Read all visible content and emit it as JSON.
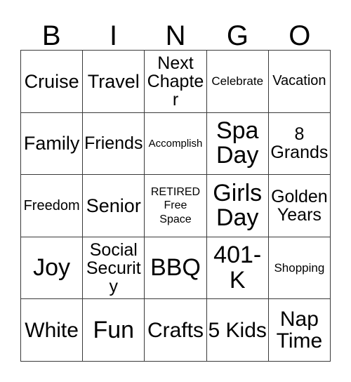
{
  "card": {
    "type": "bingo-card",
    "theme": "Retirement",
    "columns": 5,
    "rows": 5,
    "border_color": "#3a3a3a",
    "background_color": "#ffffff",
    "text_color": "#000000"
  },
  "header": {
    "letters": [
      "B",
      "I",
      "N",
      "G",
      "O"
    ]
  },
  "grid": {
    "rows": [
      [
        {
          "text": "Cruise",
          "size": "lg"
        },
        {
          "text": "Travel",
          "size": "lg"
        },
        {
          "text": "Next Chapter",
          "size": "md"
        },
        {
          "text": "Celebrate",
          "size": "xs"
        },
        {
          "text": "Vacation",
          "size": "sm"
        }
      ],
      [
        {
          "text": "Family",
          "size": "lg"
        },
        {
          "text": "Friends",
          "size": "md"
        },
        {
          "text": "Accomplish",
          "size": "xxs"
        },
        {
          "text": "Spa Day",
          "size": "xxl"
        },
        {
          "text": "8 Grands",
          "size": "md"
        }
      ],
      [
        {
          "text": "Freedom",
          "size": "sm"
        },
        {
          "text": "Senior",
          "size": "lg"
        },
        {
          "text": "RETIRED Free Space",
          "size": "free"
        },
        {
          "text": "Girls Day",
          "size": "xxl"
        },
        {
          "text": "Golden Years",
          "size": "md"
        }
      ],
      [
        {
          "text": "Joy",
          "size": "xxl"
        },
        {
          "text": "Social Security",
          "size": "md"
        },
        {
          "text": "BBQ",
          "size": "xxl"
        },
        {
          "text": "401-K",
          "size": "xxl"
        },
        {
          "text": "Shopping",
          "size": "xs"
        }
      ],
      [
        {
          "text": "White",
          "size": "xl"
        },
        {
          "text": "Fun",
          "size": "xxl"
        },
        {
          "text": "Crafts",
          "size": "xl"
        },
        {
          "text": "5 Kids",
          "size": "xl"
        },
        {
          "text": "Nap Time",
          "size": "xl"
        }
      ]
    ]
  },
  "free_space": {
    "label_line_1": "RETIRED",
    "label_line_2": "Free",
    "label_line_3": "Space",
    "position_row": 3,
    "position_column": 3
  }
}
